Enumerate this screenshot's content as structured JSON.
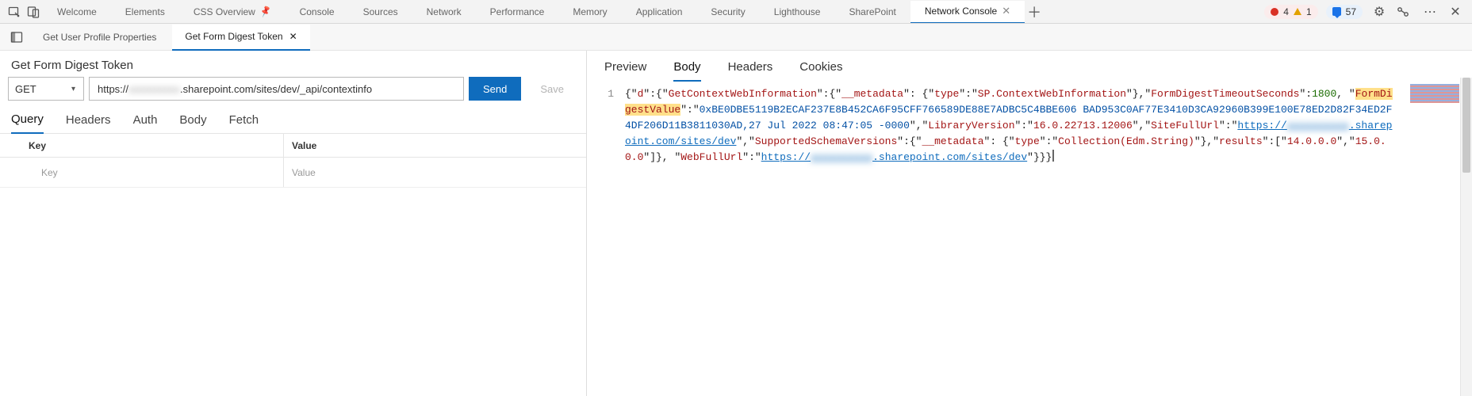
{
  "top_tabs": [
    "Welcome",
    "Elements",
    "CSS Overview",
    "Console",
    "Sources",
    "Network",
    "Performance",
    "Memory",
    "Application",
    "Security",
    "Lighthouse",
    "SharePoint",
    "Network Console"
  ],
  "top_active_index": 12,
  "css_overview_has_pin": true,
  "counts": {
    "errors": "4",
    "warnings": "1",
    "messages": "57"
  },
  "sub_tabs": [
    "Get User Profile Properties",
    "Get Form Digest Token"
  ],
  "sub_active_index": 1,
  "request": {
    "title": "Get Form Digest Token",
    "method": "GET",
    "url_prefix": "https://",
    "url_blurred": "xxxxxxxxxx",
    "url_suffix": ".sharepoint.com/sites/dev/_api/contextinfo",
    "send_label": "Send",
    "save_label": "Save",
    "req_tabs": [
      "Query",
      "Headers",
      "Auth",
      "Body",
      "Fetch"
    ],
    "req_tab_active": 0,
    "kv_header_key": "Key",
    "kv_header_val": "Value",
    "kv_placeholder_key": "Key",
    "kv_placeholder_val": "Value"
  },
  "response": {
    "tabs": [
      "Preview",
      "Body",
      "Headers",
      "Cookies"
    ],
    "active": 1,
    "line_no": "1",
    "json": {
      "p1a": "{\"",
      "k_d": "d",
      "p1b": "\":{\"",
      "k_gcwi": "GetContextWebInformation",
      "p1c": "\":{\"",
      "k_meta": "__metadata",
      "p1d": "\":",
      "p2a": "{\"",
      "k_type": "type",
      "p2b": "\":\"",
      "v_type": "SP.ContextWebInformation",
      "p2c": "\"},\"",
      "k_fdts": "FormDigestTimeoutSeconds",
      "p2d": "\":",
      "v_1800": "1800",
      "p2e": ",",
      "p3a": "\"",
      "k_fdv": "FormDigestValue",
      "p3b": "\":\"",
      "v_fdv1": "0xBE0DBE5119B2ECAF237E8B452CA6F95CFF766589DE88E7ADBC5C4BBE606",
      "v_fdv2": "BAD953C0AF77E3410D3CA92960B399E100E78ED2D82F34ED2F4DF206D11B3811030AD,27 Jul",
      "v_fdv3": "2022 08:47:05 -0000",
      "p4a": "\",\"",
      "k_libv": "LibraryVersion",
      "p4b": "\":\"",
      "v_libv": "16.0.22713.12006",
      "p4c": "\",\"",
      "k_sfu": "SiteFullUrl",
      "p4d": "\":\"",
      "v_url_pre": "https://",
      "v_url_blur": "xxxxxxxxxx",
      "v_url_suf": ".sharepoint.com/sites/dev",
      "p5a": "\",\"",
      "k_ssv": "SupportedSchemaVersions",
      "p5b": "\":{\"",
      "k_meta2": "__metadata",
      "p5c": "\":",
      "p6a": "{\"",
      "k_type2": "type",
      "p6b": "\":\"",
      "v_type2": "Collection(Edm.String)",
      "p6c": "\"},\"",
      "k_results": "results",
      "p6d": "\":[\"",
      "v_r1": "14.0.0.0",
      "p6e": "\",\"",
      "v_r2": "15.0.0.0",
      "p6f": "\"]},",
      "p7a": "\"",
      "k_wfu": "WebFullUrl",
      "p7b": "\":\"",
      "p7c": "\"}}}"
    }
  }
}
